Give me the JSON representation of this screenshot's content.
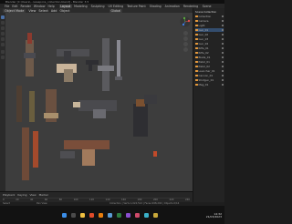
{
  "window": {
    "title": "Blender [C:\\Users\\...\\weapons_collection.blend] - Blender 3.5"
  },
  "menu": {
    "items": [
      "File",
      "Edit",
      "Render",
      "Window",
      "Help"
    ],
    "workspaces": [
      "Layout",
      "Modeling",
      "Sculpting",
      "UV Editing",
      "Texture Paint",
      "Shading",
      "Animation",
      "Rendering"
    ],
    "active_workspace": "Layout",
    "scene": "Scene"
  },
  "tool_header": {
    "mode": "Object Mode",
    "items": [
      "View",
      "Select",
      "Add",
      "Object"
    ],
    "transform": "Global"
  },
  "timeline": {
    "controls": [
      "Playback",
      "Keying",
      "View",
      "Marker"
    ],
    "ticks": [
      "0",
      "20",
      "40",
      "60",
      "80",
      "100",
      "120",
      "140",
      "160",
      "180",
      "200",
      "220",
      "240"
    ]
  },
  "outliner": {
    "header": "Scene Collection",
    "items": [
      "Collection",
      "Camera",
      "Light",
      "Gun_01",
      "Gun_02",
      "Gun_03",
      "Gun_04",
      "Rifle_01",
      "Rifle_02",
      "Blade_01",
      "Pistol_01",
      "Pistol_02",
      "Launcher_01",
      "Cannon_01",
      "Shotgun_01",
      "Mag_01"
    ]
  },
  "status": {
    "left": "Select",
    "mid": "Pan View",
    "right": "Collection | Verts 1,024,512 | Faces 998,204 | Objects 0/16"
  },
  "taskbar": {
    "time": "14:32",
    "date": "21/03/2023"
  },
  "colors": {
    "accent": "#e87d0d",
    "selection": "#4a6fa5",
    "viewport_bg": "#3d3d3d"
  }
}
